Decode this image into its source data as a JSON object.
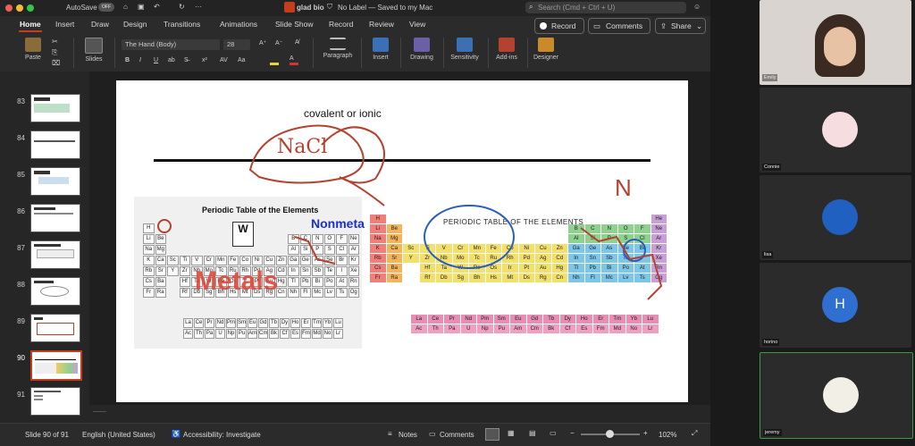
{
  "app": {
    "autosave_label": "AutoSave",
    "autosave_state": "OFF",
    "doc_title": "glad bio",
    "label_status": "No Label — Saved to my Mac",
    "search_placeholder": "Search (Cmd + Ctrl + U)"
  },
  "tabs": [
    "Home",
    "Insert",
    "Draw",
    "Design",
    "Transitions",
    "Animations",
    "Slide Show",
    "Record",
    "Review",
    "View"
  ],
  "actions": {
    "record": "Record",
    "comments": "Comments",
    "share": "Share"
  },
  "ribbon": {
    "paste": "Paste",
    "slides": "Slides",
    "font_name": "The Hand (Body)",
    "font_size": "28",
    "paragraph": "Paragraph",
    "insert": "Insert",
    "drawing": "Drawing",
    "sensitivity": "Sensitivity",
    "addins": "Add-ins",
    "designer": "Designer"
  },
  "thumbnails": [
    {
      "num": "83"
    },
    {
      "num": "84"
    },
    {
      "num": "85"
    },
    {
      "num": "86"
    },
    {
      "num": "87"
    },
    {
      "num": "88"
    },
    {
      "num": "89"
    },
    {
      "num": "90"
    },
    {
      "num": "91"
    }
  ],
  "slide": {
    "heading": "covalent or ionic",
    "handwriting_center": "NaCl",
    "handwriting_right": "N",
    "pt_left_title": "Periodic Table of the Elements",
    "pt_right_title": "PERIODIC TABLE OF THE ELEMENTS",
    "metals_label": "Metals",
    "nonmetals_label": "Nonmeta",
    "element_symbol": "W",
    "left_table_rows": [
      [
        "H",
        "",
        "",
        "",
        "",
        "",
        "",
        "",
        "",
        "",
        "",
        "",
        "",
        "",
        "",
        "",
        "",
        ""
      ],
      [
        "Li",
        "Be",
        "",
        "",
        "",
        "",
        "",
        "",
        "",
        "",
        "",
        "",
        "B",
        "C",
        "N",
        "O",
        "F",
        "Ne"
      ],
      [
        "Na",
        "Mg",
        "",
        "",
        "",
        "",
        "",
        "",
        "",
        "",
        "",
        "",
        "Al",
        "Si",
        "P",
        "S",
        "Cl",
        "Ar"
      ],
      [
        "K",
        "Ca",
        "Sc",
        "Ti",
        "V",
        "Cr",
        "Mn",
        "Fe",
        "Co",
        "Ni",
        "Cu",
        "Zn",
        "Ga",
        "Ge",
        "As",
        "Se",
        "Br",
        "Kr"
      ],
      [
        "Rb",
        "Sr",
        "Y",
        "Zr",
        "Nb",
        "Mo",
        "Tc",
        "Ru",
        "Rh",
        "Pd",
        "Ag",
        "Cd",
        "In",
        "Sn",
        "Sb",
        "Te",
        "I",
        "Xe"
      ],
      [
        "Cs",
        "Ba",
        "",
        "Hf",
        "Ta",
        "W",
        "Re",
        "Os",
        "Ir",
        "Pt",
        "Au",
        "Hg",
        "Tl",
        "Pb",
        "Bi",
        "Po",
        "At",
        "Rn"
      ],
      [
        "Fr",
        "Ra",
        "",
        "Rf",
        "Db",
        "Sg",
        "Bh",
        "Hs",
        "Mt",
        "Ds",
        "Rg",
        "Cn",
        "Nh",
        "Fl",
        "Mc",
        "Lv",
        "Ts",
        "Og"
      ]
    ],
    "left_lan_rows": [
      [
        "La",
        "Ce",
        "Pr",
        "Nd",
        "Pm",
        "Sm",
        "Eu",
        "Gd",
        "Tb",
        "Dy",
        "Ho",
        "Er",
        "Tm",
        "Yb",
        "Lu"
      ],
      [
        "Ac",
        "Th",
        "Pa",
        "U",
        "Np",
        "Pu",
        "Am",
        "Cm",
        "Bk",
        "Cf",
        "Es",
        "Fm",
        "Md",
        "No",
        "Lr"
      ]
    ],
    "right_table_rows": [
      [
        "H",
        "",
        "",
        "",
        "",
        "",
        "",
        "",
        "",
        "",
        "",
        "",
        "",
        "",
        "",
        "",
        "",
        "He"
      ],
      [
        "Li",
        "Be",
        "",
        "",
        "",
        "",
        "",
        "",
        "",
        "",
        "",
        "",
        "B",
        "C",
        "N",
        "O",
        "F",
        "Ne"
      ],
      [
        "Na",
        "Mg",
        "",
        "",
        "",
        "",
        "",
        "",
        "",
        "",
        "",
        "",
        "Al",
        "Si",
        "P",
        "S",
        "Cl",
        "Ar"
      ],
      [
        "K",
        "Ca",
        "Sc",
        "Ti",
        "V",
        "Cr",
        "Mn",
        "Fe",
        "Co",
        "Ni",
        "Cu",
        "Zn",
        "Ga",
        "Ge",
        "As",
        "Se",
        "Br",
        "Kr"
      ],
      [
        "Rb",
        "Sr",
        "Y",
        "Zr",
        "Nb",
        "Mo",
        "Tc",
        "Ru",
        "Rh",
        "Pd",
        "Ag",
        "Cd",
        "In",
        "Sn",
        "Sb",
        "Te",
        "I",
        "Xe"
      ],
      [
        "Cs",
        "Ba",
        "",
        "Hf",
        "Ta",
        "W",
        "Re",
        "Os",
        "Ir",
        "Pt",
        "Au",
        "Hg",
        "Tl",
        "Pb",
        "Bi",
        "Po",
        "At",
        "Rn"
      ],
      [
        "Fr",
        "Ra",
        "",
        "Rf",
        "Db",
        "Sg",
        "Bh",
        "Hs",
        "Mt",
        "Ds",
        "Rg",
        "Cn",
        "Nh",
        "Fl",
        "Mc",
        "Lv",
        "Ts",
        "Og"
      ]
    ],
    "right_lan_rows": [
      [
        "La",
        "Ce",
        "Pr",
        "Nd",
        "Pm",
        "Sm",
        "Eu",
        "Gd",
        "Tb",
        "Dy",
        "Ho",
        "Er",
        "Tm",
        "Yb",
        "Lu"
      ],
      [
        "Ac",
        "Th",
        "Pa",
        "U",
        "Np",
        "Pu",
        "Am",
        "Cm",
        "Bk",
        "Cf",
        "Es",
        "Fm",
        "Md",
        "No",
        "Lr"
      ]
    ]
  },
  "status": {
    "slide_counter": "Slide 90 of 91",
    "language": "English (United States)",
    "accessibility": "Accessibility: Investigate",
    "notes": "Notes",
    "comments": "Comments",
    "zoom": "102%"
  },
  "participants": [
    {
      "name": "Emily",
      "initial": ""
    },
    {
      "name": "Connie",
      "initial": ""
    },
    {
      "name": "lisa",
      "initial": ""
    },
    {
      "name": "horino",
      "initial": "H"
    },
    {
      "name": "jeremy",
      "initial": ""
    }
  ],
  "colors": {
    "accent": "#c43e1c",
    "record": "#6a3c8c",
    "drawing_red": "#b5412f",
    "drawing_blue": "#2a5fbf"
  }
}
